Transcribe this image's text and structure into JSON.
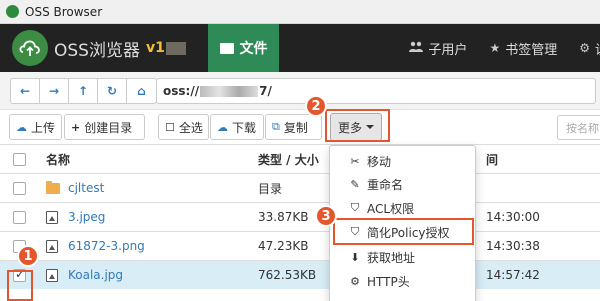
{
  "window": {
    "title": "OSS Browser"
  },
  "navbar": {
    "brand_name": "OSS浏览器",
    "version": "v1",
    "files_label": "文件",
    "items": [
      {
        "icon": "users-icon",
        "label": "子用户"
      },
      {
        "icon": "star-icon",
        "label": "书签管理"
      },
      {
        "icon": "gear-icon",
        "label": "设"
      }
    ]
  },
  "address": {
    "nav_buttons": [
      "back-icon",
      "forward-icon",
      "up-icon",
      "refresh-icon",
      "home-icon"
    ],
    "path_prefix": "oss://",
    "path_suffix": "7/"
  },
  "toolbar": {
    "upload_label": "上传",
    "mkdir_label": "创建目录",
    "select_all_label": "全选",
    "download_label": "下载",
    "copy_label": "复制",
    "more_label": "更多",
    "search_placeholder": "按名称"
  },
  "table": {
    "headers": {
      "name": "名称",
      "type_size": "类型 / 大小",
      "time": "间"
    },
    "rows": [
      {
        "name": "cjltest",
        "kind": "folder",
        "type_size": "目录",
        "time": "",
        "checked": false,
        "highlight": false
      },
      {
        "name": "3.jpeg",
        "kind": "image",
        "type_size": "33.87KB",
        "time": "14:30:00",
        "checked": false,
        "highlight": false
      },
      {
        "name": "61872-3.png",
        "kind": "image",
        "type_size": "47.23KB",
        "time": "14:30:38",
        "checked": false,
        "highlight": false
      },
      {
        "name": "Koala.jpg",
        "kind": "image",
        "type_size": "762.53KB",
        "time": "14:57:42",
        "checked": true,
        "highlight": true
      }
    ]
  },
  "more_menu": {
    "items": [
      {
        "icon": "scissors-icon",
        "label": "移动"
      },
      {
        "icon": "edit-icon",
        "label": "重命名"
      },
      {
        "icon": "shield-icon",
        "label": "ACL权限"
      },
      {
        "icon": "shield-icon",
        "label": "简化Policy授权"
      },
      {
        "icon": "download-icon",
        "label": "获取地址"
      },
      {
        "icon": "gear-icon",
        "label": "HTTP头"
      }
    ]
  },
  "annotations": {
    "badges": [
      "1",
      "2",
      "3"
    ],
    "color": "#e4572e"
  },
  "colors": {
    "navbar": "#222222",
    "active_tab": "#2e8b57",
    "link": "#337ab7",
    "highlight_row": "#d9edf7"
  }
}
